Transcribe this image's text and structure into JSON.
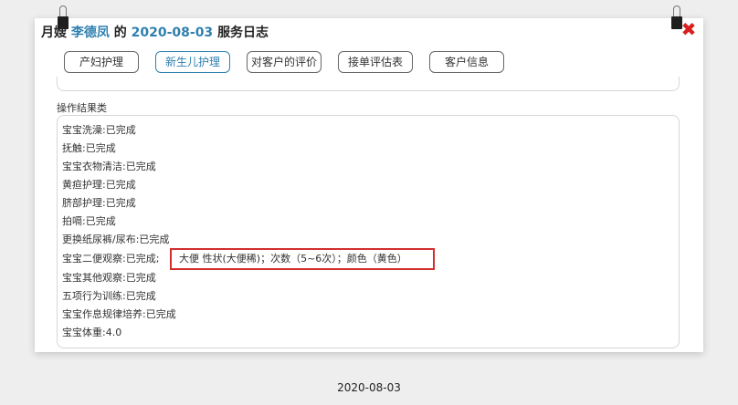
{
  "header": {
    "prefix": "月嫂",
    "name": "李德凤",
    "connector": "的",
    "date": "2020-08-03",
    "suffix": "服务日志"
  },
  "close_icon": "close-icon",
  "tabs": [
    {
      "label": "产妇护理",
      "active": false
    },
    {
      "label": "新生儿护理",
      "active": true
    },
    {
      "label": "对客户的评价",
      "active": false
    },
    {
      "label": "接单评估表",
      "active": false
    },
    {
      "label": "客户信息",
      "active": false
    }
  ],
  "section_label": "操作结果类",
  "results": [
    "宝宝洗澡:已完成",
    "抚触:已完成",
    "宝宝衣物清洁:已完成",
    "黄疸护理:已完成",
    "脐部护理:已完成",
    "拍嗝:已完成",
    "更换纸尿裤/尿布:已完成",
    "宝宝二便观察:已完成;",
    "宝宝其他观察:已完成",
    "五项行为训练:已完成",
    "宝宝作息规律培养:已完成",
    "宝宝体重:4.0"
  ],
  "highlight_detail": "大便 性状(大便稀)；次数（5~6次）；颜色（黄色）",
  "highlight_color": "#d32f2f",
  "accent_color": "#2f80b0",
  "footer_date": "2020-08-03"
}
